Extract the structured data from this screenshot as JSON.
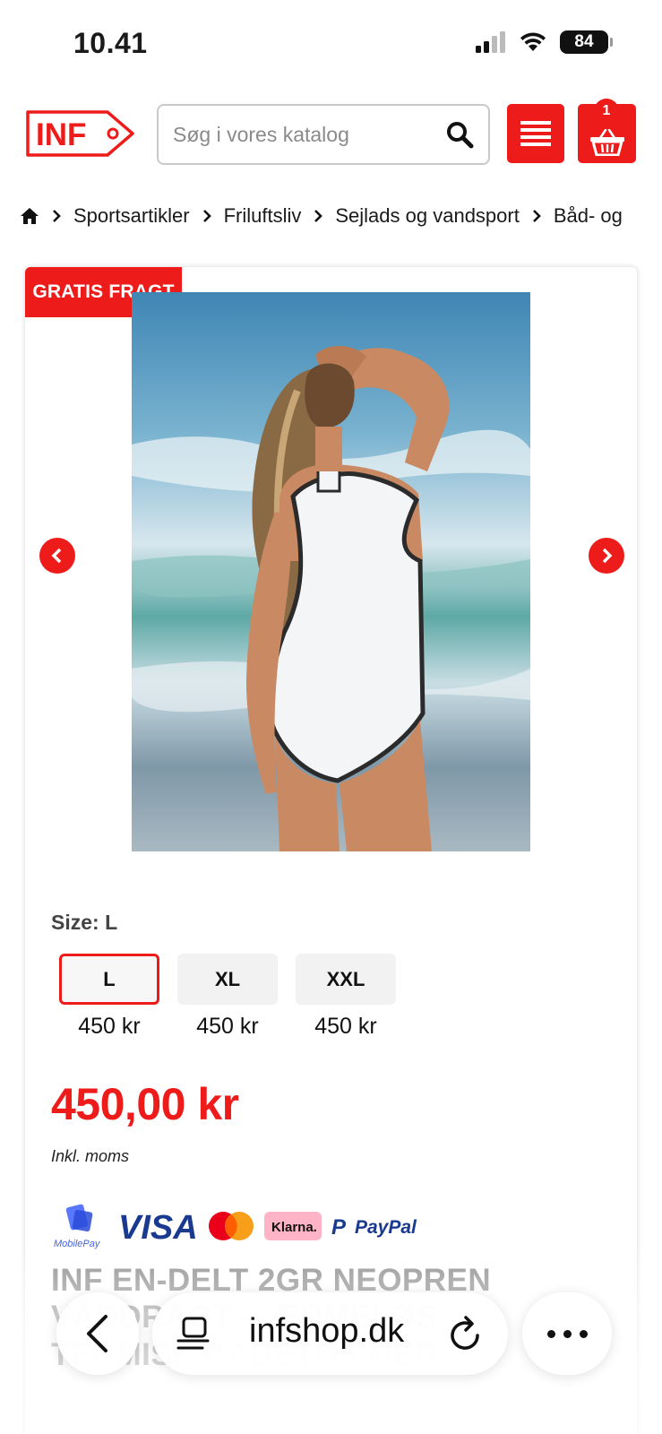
{
  "status_bar": {
    "time": "10.41",
    "battery": "84"
  },
  "header": {
    "logo_text": "INF",
    "search": {
      "placeholder": "Søg i vores katalog",
      "value": ""
    },
    "cart_count": "1"
  },
  "breadcrumb": [
    "Sportsartikler",
    "Friluftsliv",
    "Sejlads og vandsport",
    "Båd- og"
  ],
  "product": {
    "badge": "GRATIS FRAGT",
    "size_label": "Size: L",
    "sizes": [
      {
        "label": "L",
        "price": "450 kr",
        "selected": true
      },
      {
        "label": "XL",
        "price": "450 kr",
        "selected": false
      },
      {
        "label": "XXL",
        "price": "450 kr",
        "selected": false
      }
    ],
    "price": "450,00 kr",
    "vat_note": "Inkl. moms",
    "payment_methods": [
      "MobilePay",
      "VISA",
      "Mastercard",
      "Klarna.",
      "PayPal"
    ],
    "payment_labels": {
      "mobilepay": "MobilePay",
      "visa": "VISA",
      "klarna": "Klarna.",
      "paypal": "PayPal"
    },
    "title_lines": [
      "INF EN-DELT 2GR NEOPREN",
      "VÅDDRAGT – ÆRMELØS",
      "TERMISK BADETØJ MED"
    ]
  },
  "browser": {
    "address": "infshop.dk"
  },
  "colors": {
    "brand_red": "#ee1b1b",
    "title_gray": "#8d8d8d"
  }
}
